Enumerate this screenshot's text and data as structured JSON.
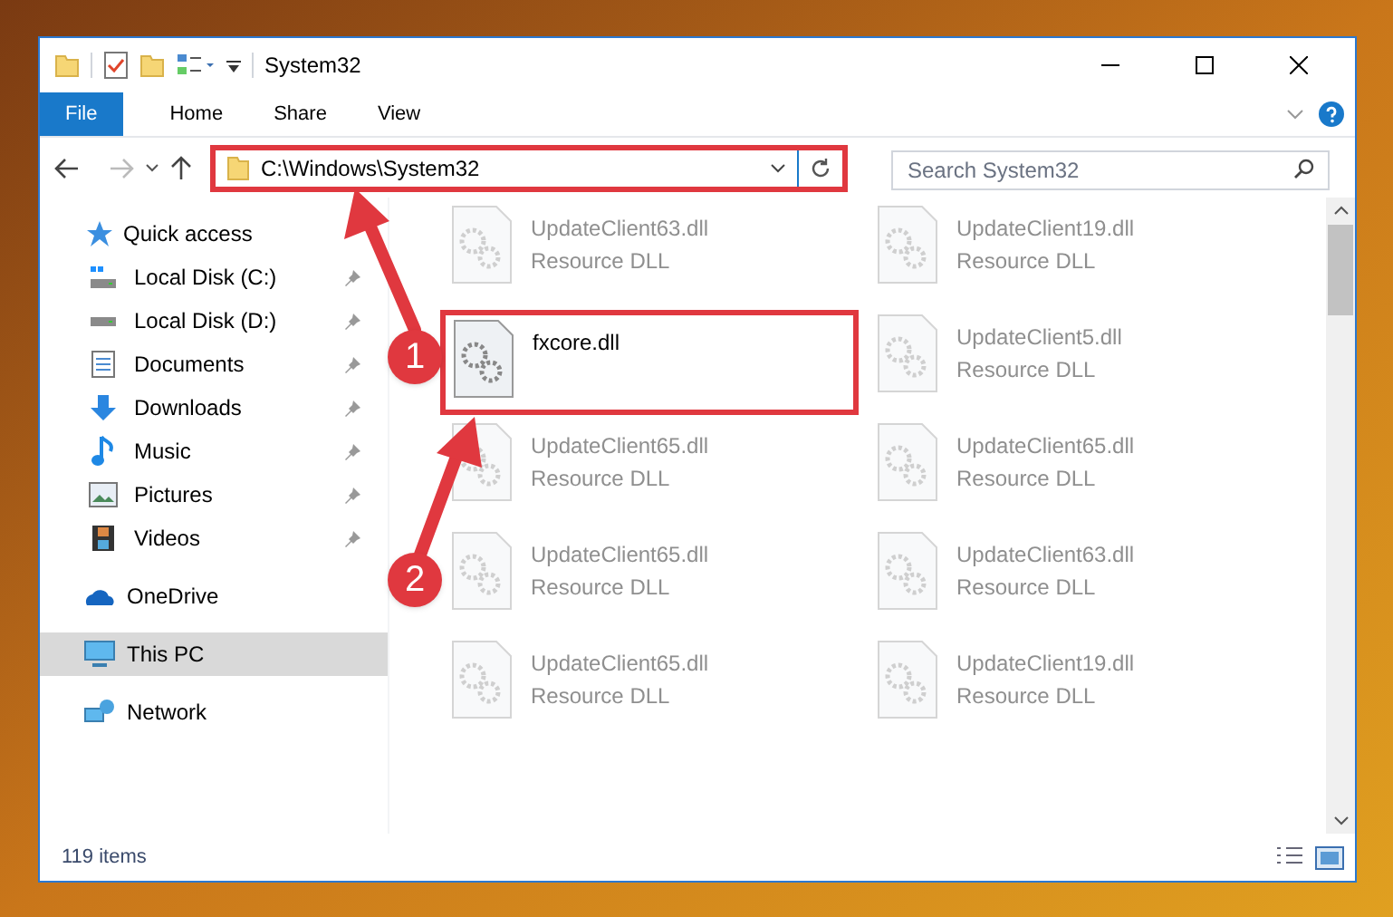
{
  "window": {
    "title": "System32"
  },
  "ribbon": {
    "file_tab": "File",
    "tabs": [
      {
        "label": "Home",
        "selected": false
      },
      {
        "label": "Share",
        "selected": false
      },
      {
        "label": "View",
        "selected": false
      }
    ]
  },
  "address_bar": {
    "path": "C:\\Windows\\System32",
    "highlighted": true
  },
  "search": {
    "placeholder": "Search System32"
  },
  "navigation": [
    {
      "label": "Quick access",
      "selected": false,
      "children": [
        {
          "label": "Local Disk (C:)",
          "pinned": true,
          "selected": false
        },
        {
          "label": "Local Disk (D:)",
          "pinned": true,
          "selected": false
        },
        {
          "label": "Documents",
          "pinned": true,
          "selected": false
        },
        {
          "label": "Downloads",
          "pinned": true,
          "selected": false
        },
        {
          "label": "Music",
          "pinned": true,
          "selected": false
        },
        {
          "label": "Pictures",
          "pinned": true,
          "selected": false
        },
        {
          "label": "Videos",
          "pinned": true,
          "selected": false
        }
      ]
    },
    {
      "label": "OneDrive",
      "selected": false
    },
    {
      "label": "This PC",
      "selected": true
    },
    {
      "label": "Network",
      "selected": false
    }
  ],
  "files": [
    {
      "name": "UpdateClient63.dll",
      "type": "Resource DLL",
      "dimmed": true,
      "highlighted": false
    },
    {
      "name": "UpdateClient19.dll",
      "type": "Resource DLL",
      "dimmed": true,
      "highlighted": false
    },
    {
      "name": "fxcore.dll",
      "dimmed": false,
      "highlighted": true
    },
    {
      "name": "UpdateClient5.dll",
      "type": "Resource DLL",
      "dimmed": true,
      "highlighted": false
    },
    {
      "name": "UpdateClient65.dll",
      "type": "Resource DLL",
      "dimmed": true,
      "highlighted": false
    },
    {
      "name": "UpdateClient65.dll",
      "type": "Resource DLL",
      "dimmed": true,
      "highlighted": false
    },
    {
      "name": "UpdateClient65.dll",
      "type": "Resource DLL",
      "dimmed": true,
      "highlighted": false
    },
    {
      "name": "UpdateClient63.dll",
      "type": "Resource DLL",
      "dimmed": true,
      "highlighted": false
    },
    {
      "name": "UpdateClient65.dll",
      "type": "Resource DLL",
      "dimmed": true,
      "highlighted": false
    },
    {
      "name": "UpdateClient19.dll",
      "type": "Resource DLL",
      "dimmed": true,
      "highlighted": false
    }
  ],
  "status_bar": {
    "item_count": "119 items"
  },
  "annotations": [
    {
      "label": "1"
    },
    {
      "label": "2"
    }
  ]
}
